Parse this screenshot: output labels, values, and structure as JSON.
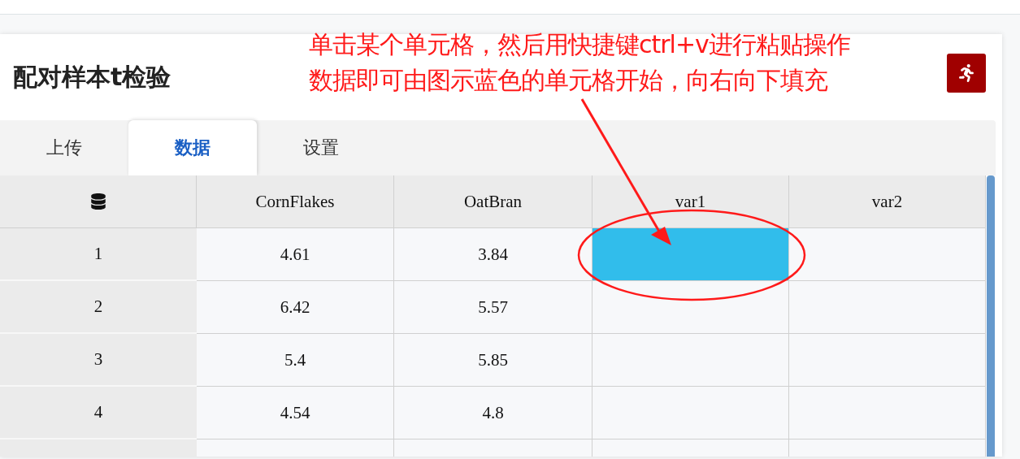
{
  "title": "配对样本t检验",
  "tabs": [
    {
      "label": "上传",
      "selected": false
    },
    {
      "label": "数据",
      "selected": true
    },
    {
      "label": "设置",
      "selected": false
    }
  ],
  "table": {
    "columns": [
      "CornFlakes",
      "OatBran",
      "var1",
      "var2"
    ],
    "rows": [
      {
        "index": "1",
        "cells": [
          {
            "value": "4.61",
            "selected": false
          },
          {
            "value": "3.84",
            "selected": false
          },
          {
            "selected": true
          },
          {
            "selected": false
          }
        ]
      },
      {
        "index": "2",
        "cells": [
          {
            "value": "6.42",
            "selected": false
          },
          {
            "value": "5.57",
            "selected": false
          },
          {
            "selected": false
          },
          {
            "selected": false
          }
        ]
      },
      {
        "index": "3",
        "cells": [
          {
            "value": "5.4",
            "selected": false
          },
          {
            "value": "5.85",
            "selected": false
          },
          {
            "selected": false
          },
          {
            "selected": false
          }
        ]
      },
      {
        "index": "4",
        "cells": [
          {
            "value": "4.54",
            "selected": false
          },
          {
            "value": "4.8",
            "selected": false
          },
          {
            "selected": false
          },
          {
            "selected": false
          }
        ]
      }
    ]
  },
  "annotation": {
    "lines": [
      "单击某个单元格，然后用快捷键ctrl+v进行粘贴操作",
      "数据即可由图示蓝色的单元格开始，向右向下填充"
    ]
  }
}
